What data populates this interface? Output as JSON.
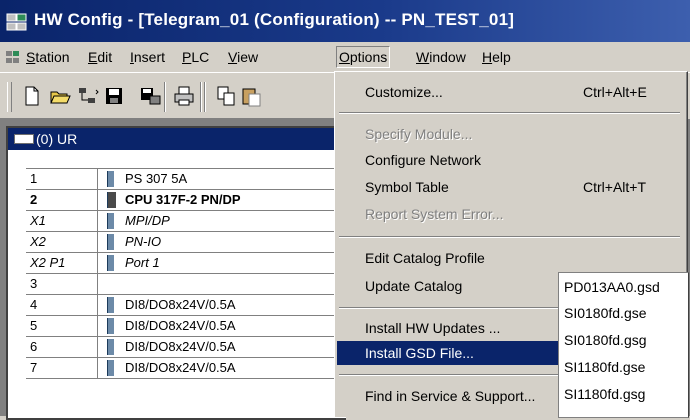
{
  "window": {
    "title": "HW Config - [Telegram_01 (Configuration) -- PN_TEST_01]"
  },
  "menubar": {
    "items": [
      {
        "label": "Station",
        "u": "S"
      },
      {
        "label": "Edit",
        "u": "E"
      },
      {
        "label": "Insert",
        "u": "I"
      },
      {
        "label": "PLC",
        "u": "P"
      },
      {
        "label": "View",
        "u": "V"
      },
      {
        "label": "Options",
        "u": "O"
      },
      {
        "label": "Window",
        "u": "W"
      },
      {
        "label": "Help",
        "u": "H"
      }
    ]
  },
  "station": {
    "title": "(0) UR",
    "rows": [
      {
        "slot": "1",
        "module": "PS 307 5A"
      },
      {
        "slot": "2",
        "module": "CPU 317F-2 PN/DP"
      },
      {
        "slot": "X1",
        "module": "MPI/DP"
      },
      {
        "slot": "X2",
        "module": "PN-IO"
      },
      {
        "slot": "X2 P1",
        "module": "Port 1"
      },
      {
        "slot": "3",
        "module": ""
      },
      {
        "slot": "4",
        "module": "DI8/DO8x24V/0.5A"
      },
      {
        "slot": "5",
        "module": "DI8/DO8x24V/0.5A"
      },
      {
        "slot": "6",
        "module": "DI8/DO8x24V/0.5A"
      },
      {
        "slot": "7",
        "module": "DI8/DO8x24V/0.5A"
      }
    ]
  },
  "options_menu": {
    "customize": {
      "label": "Customize...",
      "shortcut": "Ctrl+Alt+E"
    },
    "specify_module": {
      "label": "Specify Module..."
    },
    "configure_network": {
      "label": "Configure Network"
    },
    "symbol_table": {
      "label": "Symbol Table",
      "shortcut": "Ctrl+Alt+T"
    },
    "report_system_error": {
      "label": "Report System Error..."
    },
    "edit_catalog_profile": {
      "label": "Edit Catalog Profile"
    },
    "update_catalog": {
      "label": "Update Catalog"
    },
    "install_hw_updates": {
      "label": "Install HW Updates ..."
    },
    "install_gsd_file": {
      "label": "Install GSD File..."
    },
    "find_service": {
      "label": "Find in Service & Support..."
    }
  },
  "gsd_submenu": {
    "items": [
      "PD013AA0.gsd",
      "SI0180fd.gse",
      "SI0180fd.gsg",
      "SI1180fd.gse",
      "SI1180fd.gsg"
    ]
  },
  "colors": {
    "title_blue": "#0a246a",
    "menu_face": "#d4d0c8",
    "highlight": "#0a246a"
  }
}
